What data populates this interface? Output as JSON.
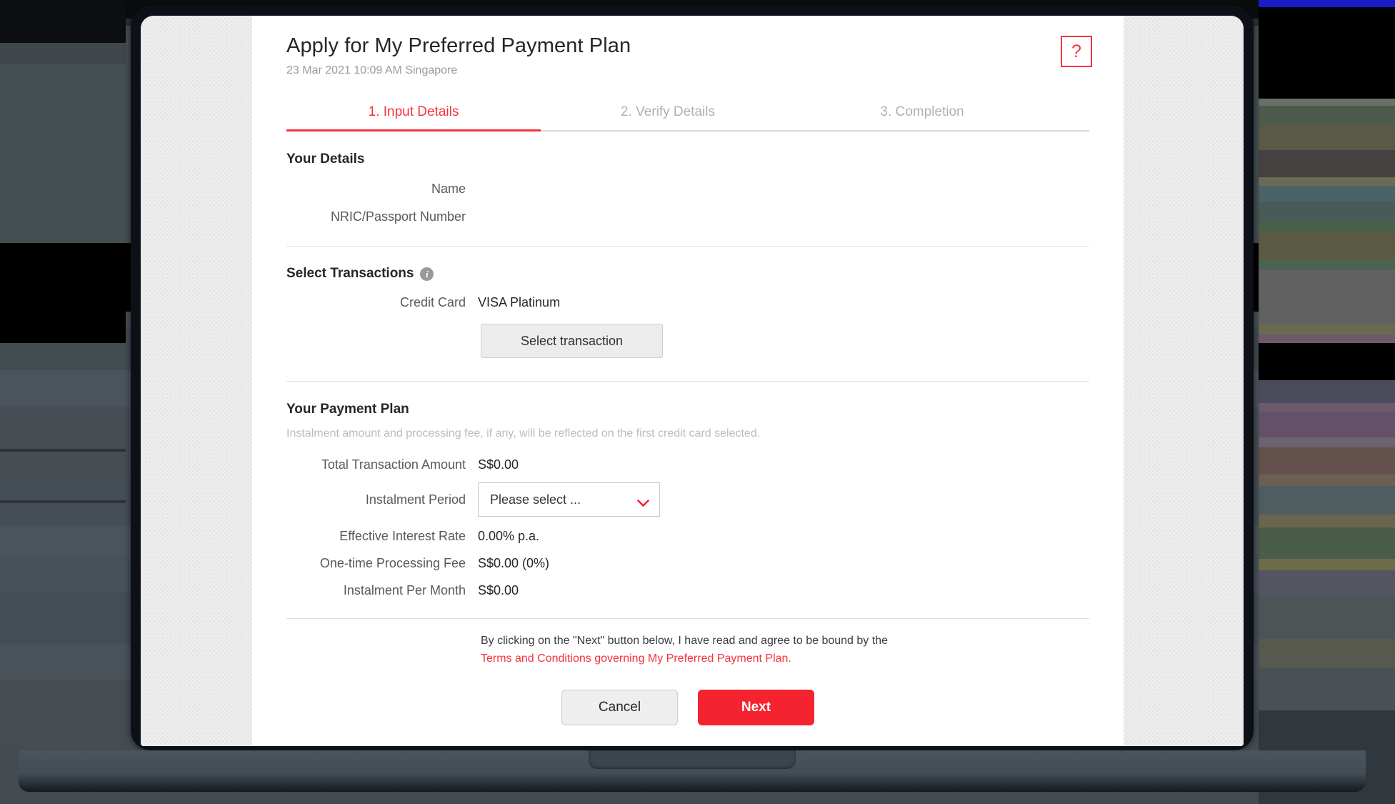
{
  "header": {
    "title": "Apply for My Preferred Payment Plan",
    "timestamp": "23 Mar 2021 10:09 AM Singapore",
    "help_label": "?"
  },
  "tabs": [
    {
      "label": "1. Input Details",
      "active": true
    },
    {
      "label": "2. Verify Details",
      "active": false
    },
    {
      "label": "3. Completion",
      "active": false
    }
  ],
  "your_details": {
    "heading": "Your Details",
    "rows": [
      {
        "label": "Name",
        "value": ""
      },
      {
        "label": "NRIC/Passport Number",
        "value": ""
      }
    ]
  },
  "select_transactions": {
    "heading": "Select Transactions",
    "info_icon": "i",
    "credit_card_label": "Credit Card",
    "credit_card_value": "VISA Platinum",
    "select_transaction_button": "Select transaction"
  },
  "payment_plan": {
    "heading": "Your Payment Plan",
    "note": "Instalment amount and processing fee, if any, will be reflected on the first credit card selected.",
    "total_label": "Total Transaction Amount",
    "total_value": "S$0.00",
    "period_label": "Instalment Period",
    "period_value": "Please select ...",
    "rows": [
      {
        "label": "Effective Interest Rate",
        "value": "0.00% p.a."
      },
      {
        "label": "One-time Processing Fee",
        "value": "S$0.00 (0%)"
      },
      {
        "label": "Instalment Per Month",
        "value": "S$0.00"
      }
    ]
  },
  "terms": {
    "line1": "By clicking on the \"Next\" button below, I have read and agree to be bound by the",
    "link": "Terms and Conditions governing My Preferred Payment Plan."
  },
  "actions": {
    "cancel": "Cancel",
    "next": "Next"
  },
  "colors": {
    "accent_red": "#f5333f",
    "next_red": "#f5232f",
    "muted": "#b0b0b0",
    "text": "#262626"
  }
}
